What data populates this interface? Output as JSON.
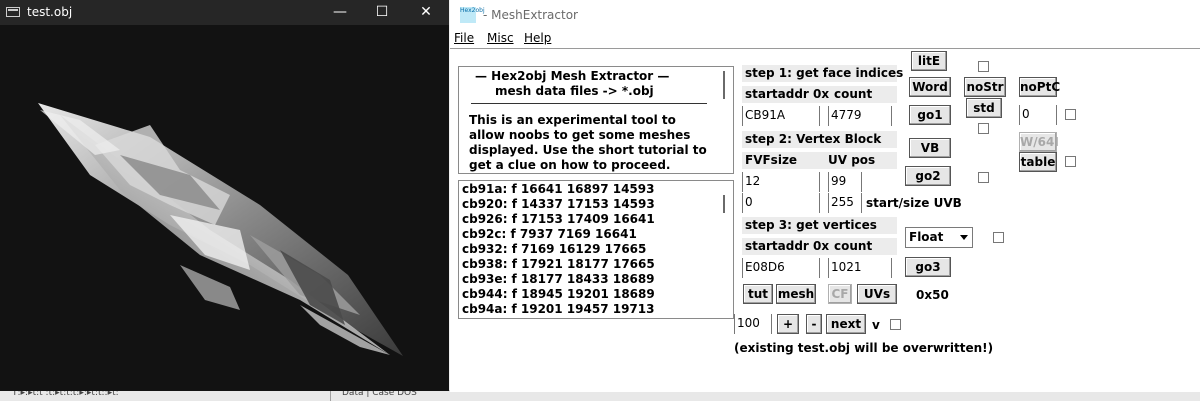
{
  "viewer": {
    "title": "test.obj",
    "controls": {
      "minimize": "—",
      "maximize": "☐",
      "close": "✕"
    }
  },
  "app": {
    "title": "- MeshExtractor",
    "logo_text": "Hex2obj",
    "menu": [
      "File",
      "Misc",
      "Help"
    ],
    "intro": {
      "heading1": "—    Hex2obj Mesh Extractor    —",
      "heading2": "mesh data files -> *.obj",
      "body": "This is an experimental tool to allow noobs to get some meshes displayed. Use the short tutorial to get a clue on how to proceed."
    },
    "faces": [
      "cb91a: f  16641 16897 14593",
      "cb920: f  14337 17153 14593",
      "cb926: f  17153 17409 16641",
      "cb92c: f  7937 7169 16641",
      "cb932: f  7169 16129 17665",
      "cb938: f  17921 18177 17665",
      "cb93e: f  18177 18433 18689",
      "cb944: f  18945 19201 18689",
      "cb94a: f  19201 19457 19713"
    ],
    "step1": {
      "label": "step 1: get face indices",
      "startaddr_label": "startaddr 0x",
      "count_label": "count",
      "startaddr": "CB91A",
      "count": "4779"
    },
    "step2": {
      "label": "step 2: Vertex Block",
      "fvf_label": "FVFsize",
      "uvpos_label": "UV pos",
      "fvf": "12",
      "uvpos": "99",
      "start": "0",
      "size": "255",
      "start_size_label": "start/size UVB"
    },
    "step3": {
      "label": "step 3: get vertices",
      "startaddr_label": "startaddr 0x",
      "count_label": "count",
      "startaddr": "E08D6",
      "count": "1021"
    },
    "buttons": {
      "litE": "litE",
      "word": "Word",
      "go1": "go1",
      "vb": "VB",
      "go2": "go2",
      "go3": "go3",
      "nostr": "noStr",
      "std": "std",
      "noptc": "noPtC",
      "w64": "W/64I",
      "table": "table",
      "tut": "tut",
      "mesh": "mesh",
      "cf": "CF",
      "uvs": "UVs",
      "plus": "+",
      "minus": "-",
      "next": "next"
    },
    "format_select": "Float",
    "field_right": "0",
    "hex_label": "0x50",
    "step_value": "100",
    "v_label": "v",
    "warning": "(existing test.obj will be overwritten!)"
  },
  "background": {
    "left_text": "Ṫ꞉▸꞉▸ṫ꞉ṫ ꞉ṫ꞉▸ṫ꞉ṫ꞉ṫ꞉▸꞉▸ṫ꞉ṫ꞉꞉▸ṫ꞉",
    "right_text": "Data | Case DOS"
  }
}
